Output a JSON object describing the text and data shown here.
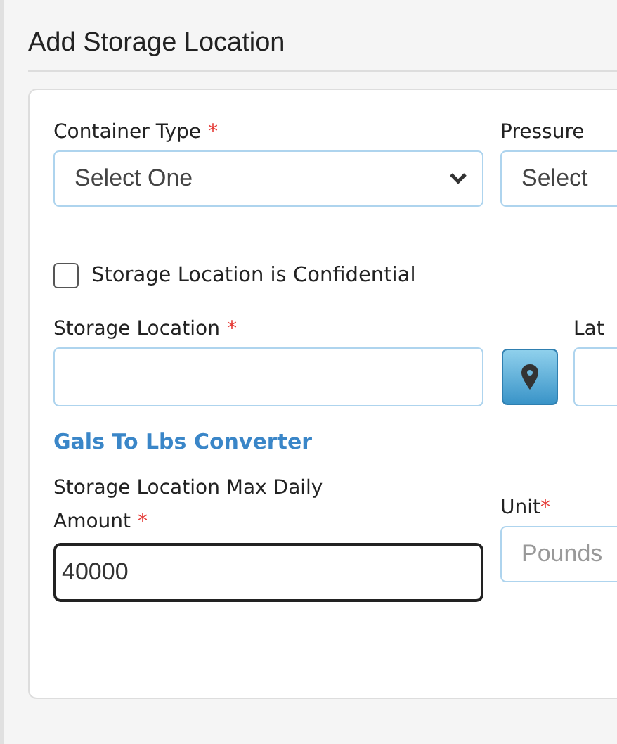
{
  "title": "Add Storage Location",
  "selects": [
    {
      "label": "Container Type",
      "mark": "*",
      "value": "Select One"
    },
    {
      "label": "Pressure",
      "value": "Select"
    }
  ],
  "confidential": {
    "label": "Storage Location is Confidential",
    "checked": false
  },
  "location": {
    "label": "Storage Location",
    "mark": "*"
  },
  "latitude": {
    "label": "Lat"
  },
  "converter_link": "Gals To Lbs Converter",
  "amount": {
    "label_lines": [
      "Storage Location Max Daily",
      "Amount"
    ],
    "mark": "*",
    "value": "40000",
    "focused": true
  },
  "unit": {
    "label": "Unit",
    "mark": "*",
    "placeholder": "Pounds"
  }
}
